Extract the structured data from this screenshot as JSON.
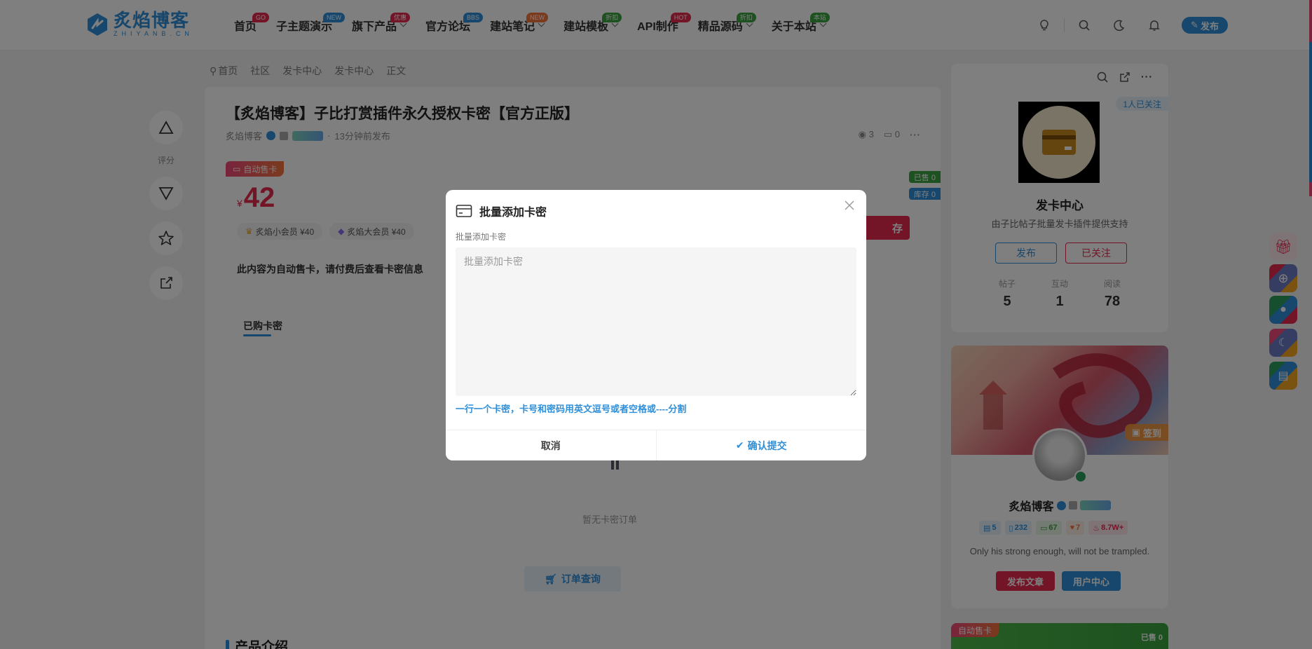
{
  "header": {
    "logo_cn": "炙焰博客",
    "logo_en": "ZHIYANB.CN",
    "nav": [
      {
        "label": "首页",
        "badge": "GO",
        "badge_color": "#e8284f",
        "dropdown": false
      },
      {
        "label": "子主题演示",
        "badge": "NEW",
        "badge_color": "#2f8fd8",
        "dropdown": false
      },
      {
        "label": "旗下产品",
        "badge": "优惠",
        "badge_color": "#e8284f",
        "dropdown": true
      },
      {
        "label": "官方论坛",
        "badge": "BBS",
        "badge_color": "#2f8fd8",
        "dropdown": false
      },
      {
        "label": "建站笔记",
        "badge": "NEW",
        "badge_color": "#f5743d",
        "dropdown": true
      },
      {
        "label": "建站模板",
        "badge": "折扣",
        "badge_color": "#3aa340",
        "dropdown": true
      },
      {
        "label": "API制作",
        "badge": "HOT",
        "badge_color": "#e8284f",
        "dropdown": false
      },
      {
        "label": "精品源码",
        "badge": "折扣",
        "badge_color": "#3aa340",
        "dropdown": true
      },
      {
        "label": "关于本站",
        "badge": "本站",
        "badge_color": "#3aa340",
        "dropdown": true
      }
    ],
    "publish": "发布"
  },
  "left_actions": {
    "rate_label": "评分"
  },
  "breadcrumb": [
    "首页",
    "社区",
    "发卡中心",
    "发卡中心",
    "正文"
  ],
  "post": {
    "title": "【炙焰博客】子比打赏插件永久授权卡密【官方正版】",
    "author": "炙焰博客",
    "time": "13分钟前发布",
    "views": "3",
    "comments": "0",
    "auto_tag": "自动售卡",
    "currency": "¥",
    "price": "42",
    "vip1": "炙焰小会员 ¥40",
    "vip2": "炙焰大会员 ¥40",
    "sold": "已售 0",
    "stock": "库存 0",
    "buy_label": "存",
    "notice": "此内容为自动售卡，请付费后查看卡密信息",
    "tab_bought": "已购卡密",
    "empty_text": "暂无卡密订单",
    "order_query": "订单查询",
    "intro_title": "产品介绍"
  },
  "sidebar": {
    "follow_count": "1人已关注",
    "forum_name": "发卡中心",
    "forum_desc": "由子比帖子批量发卡插件提供支持",
    "publish_btn": "发布",
    "followed_btn": "已关注",
    "stats": [
      {
        "label": "帖子",
        "value": "5"
      },
      {
        "label": "互动",
        "value": "1"
      },
      {
        "label": "阅读",
        "value": "78"
      }
    ],
    "checkin": "签到",
    "user_name": "炙焰博客",
    "user_stats": [
      {
        "value": "5",
        "color": "#2f8fd8",
        "bg": "#e8f2fc"
      },
      {
        "value": "232",
        "color": "#2f8fd8",
        "bg": "#e8f2fc"
      },
      {
        "value": "67",
        "color": "#3aa340",
        "bg": "#e7f6e6"
      },
      {
        "value": "7",
        "color": "#f5743d",
        "bg": "#fdeee5"
      },
      {
        "value": "8.7W+",
        "color": "#e8284f",
        "bg": "#fde8ec"
      }
    ],
    "bio": "Only his strong enough, will not be trampled.",
    "btn_post": "发布文章",
    "btn_user": "用户中心",
    "card3_tag": "自动售卡",
    "card3_sold": "已售 0"
  },
  "modal": {
    "title": "批量添加卡密",
    "field_label": "批量添加卡密",
    "placeholder": "批量添加卡密",
    "hint": "一行一个卡密，卡号和密码用英文逗号或者空格或----分割",
    "cancel": "取消",
    "confirm": "确认提交"
  },
  "colors": {
    "accent": "#2f8fd8",
    "danger": "#e8284f",
    "success": "#3aa340"
  }
}
